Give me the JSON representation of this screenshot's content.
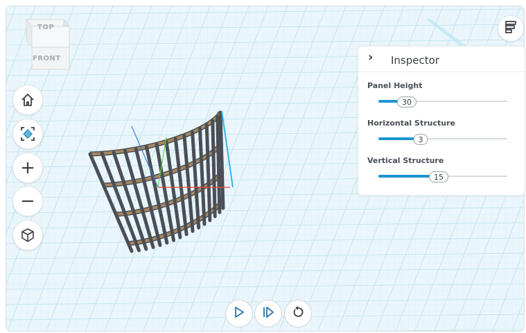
{
  "viewcube": {
    "top_label": "TOP",
    "front_label": "FRONT"
  },
  "toolbar": {
    "home_icon": "home-icon",
    "fit_icon": "fit-view-icon",
    "zoom_in_icon": "plus-icon",
    "zoom_out_icon": "minus-icon",
    "perspective_icon": "cube-icon"
  },
  "settings_icon": "settings-panel-icon",
  "inspector": {
    "title": "Inspector",
    "properties": [
      {
        "label": "Panel Height",
        "value": "30",
        "fraction": 0.22
      },
      {
        "label": "Horizontal Structure",
        "value": "3",
        "fraction": 0.33
      },
      {
        "label": "Vertical Structure",
        "value": "15",
        "fraction": 0.47
      }
    ]
  },
  "playback": {
    "play_icon": "play-icon",
    "step_icon": "step-forward-icon",
    "reset_icon": "reset-icon"
  },
  "colors": {
    "accent": "#1a96d4",
    "grid": "#c5e3ef",
    "wood": "#a9875e",
    "frame": "#4b4f55",
    "selection": "#33b5e5"
  }
}
